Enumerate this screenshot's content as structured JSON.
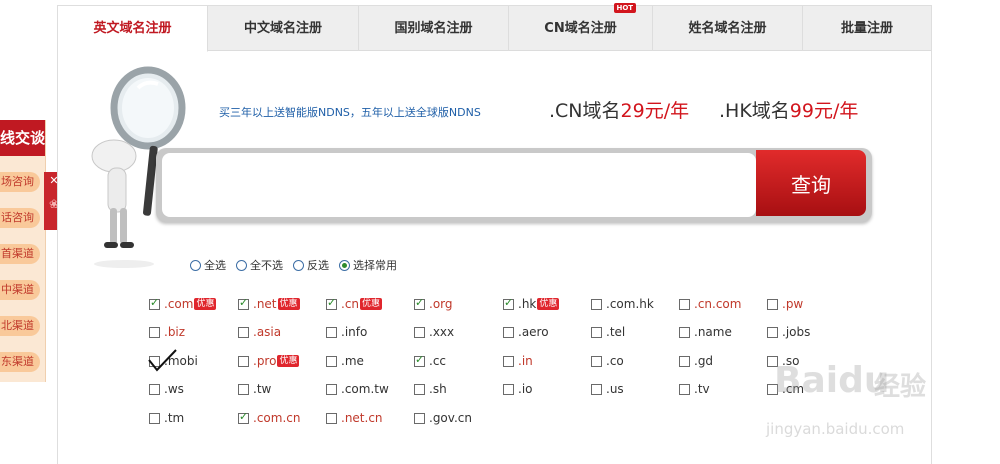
{
  "left_panel": {
    "title": "线交谈",
    "items": [
      "场咨询",
      "话咨询",
      "首渠道",
      "中渠道",
      "北渠道",
      "东渠道"
    ],
    "close_symbol": "✕"
  },
  "tabs": [
    {
      "label": "英文域名注册",
      "active": true
    },
    {
      "label": "中文域名注册",
      "active": false
    },
    {
      "label": "国别域名注册",
      "active": false
    },
    {
      "label": "CN域名注册",
      "active": false,
      "badge": "HOT"
    },
    {
      "label": "姓名域名注册",
      "active": false
    },
    {
      "label": "批量注册",
      "active": false
    }
  ],
  "promo_text": "买三年以上送智能版NDNS，五年以上送全球版NDNS",
  "prices": [
    {
      "prefix": ".CN域名",
      "amount": "29元",
      "suffix": "/年"
    },
    {
      "prefix": ".HK域名",
      "amount": "99元",
      "suffix": "/年"
    }
  ],
  "search": {
    "value": "",
    "placeholder": "",
    "button_label": "查询"
  },
  "selection_options": [
    {
      "label": "全选",
      "selected": false
    },
    {
      "label": "全不选",
      "selected": false
    },
    {
      "label": "反选",
      "selected": false
    },
    {
      "label": "选择常用",
      "selected": true
    }
  ],
  "promo_badge": "优惠",
  "domains": [
    [
      {
        "name": ".com",
        "checked": true,
        "red": true,
        "badge": true
      },
      {
        "name": ".net",
        "checked": true,
        "red": true,
        "badge": true
      },
      {
        "name": ".cn",
        "checked": true,
        "red": true,
        "badge": true
      },
      {
        "name": ".org",
        "checked": true,
        "red": true,
        "badge": false
      },
      {
        "name": ".hk",
        "checked": true,
        "red": false,
        "badge": true
      },
      {
        "name": ".com.hk",
        "checked": false,
        "red": false,
        "badge": false
      },
      {
        "name": ".cn.com",
        "checked": false,
        "red": true,
        "badge": false
      },
      {
        "name": ".pw",
        "checked": false,
        "red": true,
        "badge": false
      }
    ],
    [
      {
        "name": ".biz",
        "checked": false,
        "red": true,
        "badge": false
      },
      {
        "name": ".asia",
        "checked": false,
        "red": true,
        "badge": false
      },
      {
        "name": ".info",
        "checked": false,
        "red": false,
        "badge": false
      },
      {
        "name": ".xxx",
        "checked": false,
        "red": false,
        "badge": false
      },
      {
        "name": ".aero",
        "checked": false,
        "red": false,
        "badge": false
      },
      {
        "name": ".tel",
        "checked": false,
        "red": false,
        "badge": false
      },
      {
        "name": ".name",
        "checked": false,
        "red": false,
        "badge": false
      },
      {
        "name": ".jobs",
        "checked": false,
        "red": false,
        "badge": false
      }
    ],
    [
      {
        "name": ".mobi",
        "checked": false,
        "red": false,
        "badge": false
      },
      {
        "name": ".pro",
        "checked": false,
        "red": true,
        "badge": true
      },
      {
        "name": ".me",
        "checked": false,
        "red": false,
        "badge": false
      },
      {
        "name": ".cc",
        "checked": true,
        "red": false,
        "badge": false
      },
      {
        "name": ".in",
        "checked": false,
        "red": true,
        "badge": false
      },
      {
        "name": ".co",
        "checked": false,
        "red": false,
        "badge": false
      },
      {
        "name": ".gd",
        "checked": false,
        "red": false,
        "badge": false
      },
      {
        "name": ".so",
        "checked": false,
        "red": false,
        "badge": false
      }
    ],
    [
      {
        "name": ".ws",
        "checked": false,
        "red": false,
        "badge": false
      },
      {
        "name": ".tw",
        "checked": false,
        "red": false,
        "badge": false
      },
      {
        "name": ".com.tw",
        "checked": false,
        "red": false,
        "badge": false
      },
      {
        "name": ".sh",
        "checked": false,
        "red": false,
        "badge": false
      },
      {
        "name": ".io",
        "checked": false,
        "red": false,
        "badge": false
      },
      {
        "name": ".us",
        "checked": false,
        "red": false,
        "badge": false
      },
      {
        "name": ".tv",
        "checked": false,
        "red": false,
        "badge": false
      },
      {
        "name": ".cm",
        "checked": false,
        "red": false,
        "badge": false
      }
    ],
    [
      {
        "name": ".tm",
        "checked": false,
        "red": false,
        "badge": false
      },
      {
        "name": ".com.cn",
        "checked": true,
        "red": true,
        "badge": false
      },
      {
        "name": ".net.cn",
        "checked": false,
        "red": true,
        "badge": false
      },
      {
        "name": ".gov.cn",
        "checked": false,
        "red": false,
        "badge": false
      }
    ]
  ],
  "watermark": {
    "logo": "Bai",
    "logo_suffix": "du",
    "cn": "经验",
    "url": "jingyan.baidu.com"
  },
  "colors": {
    "brand_red": "#c01922",
    "link_blue": "#1f5fa8",
    "check_green": "#2a8a2a"
  }
}
